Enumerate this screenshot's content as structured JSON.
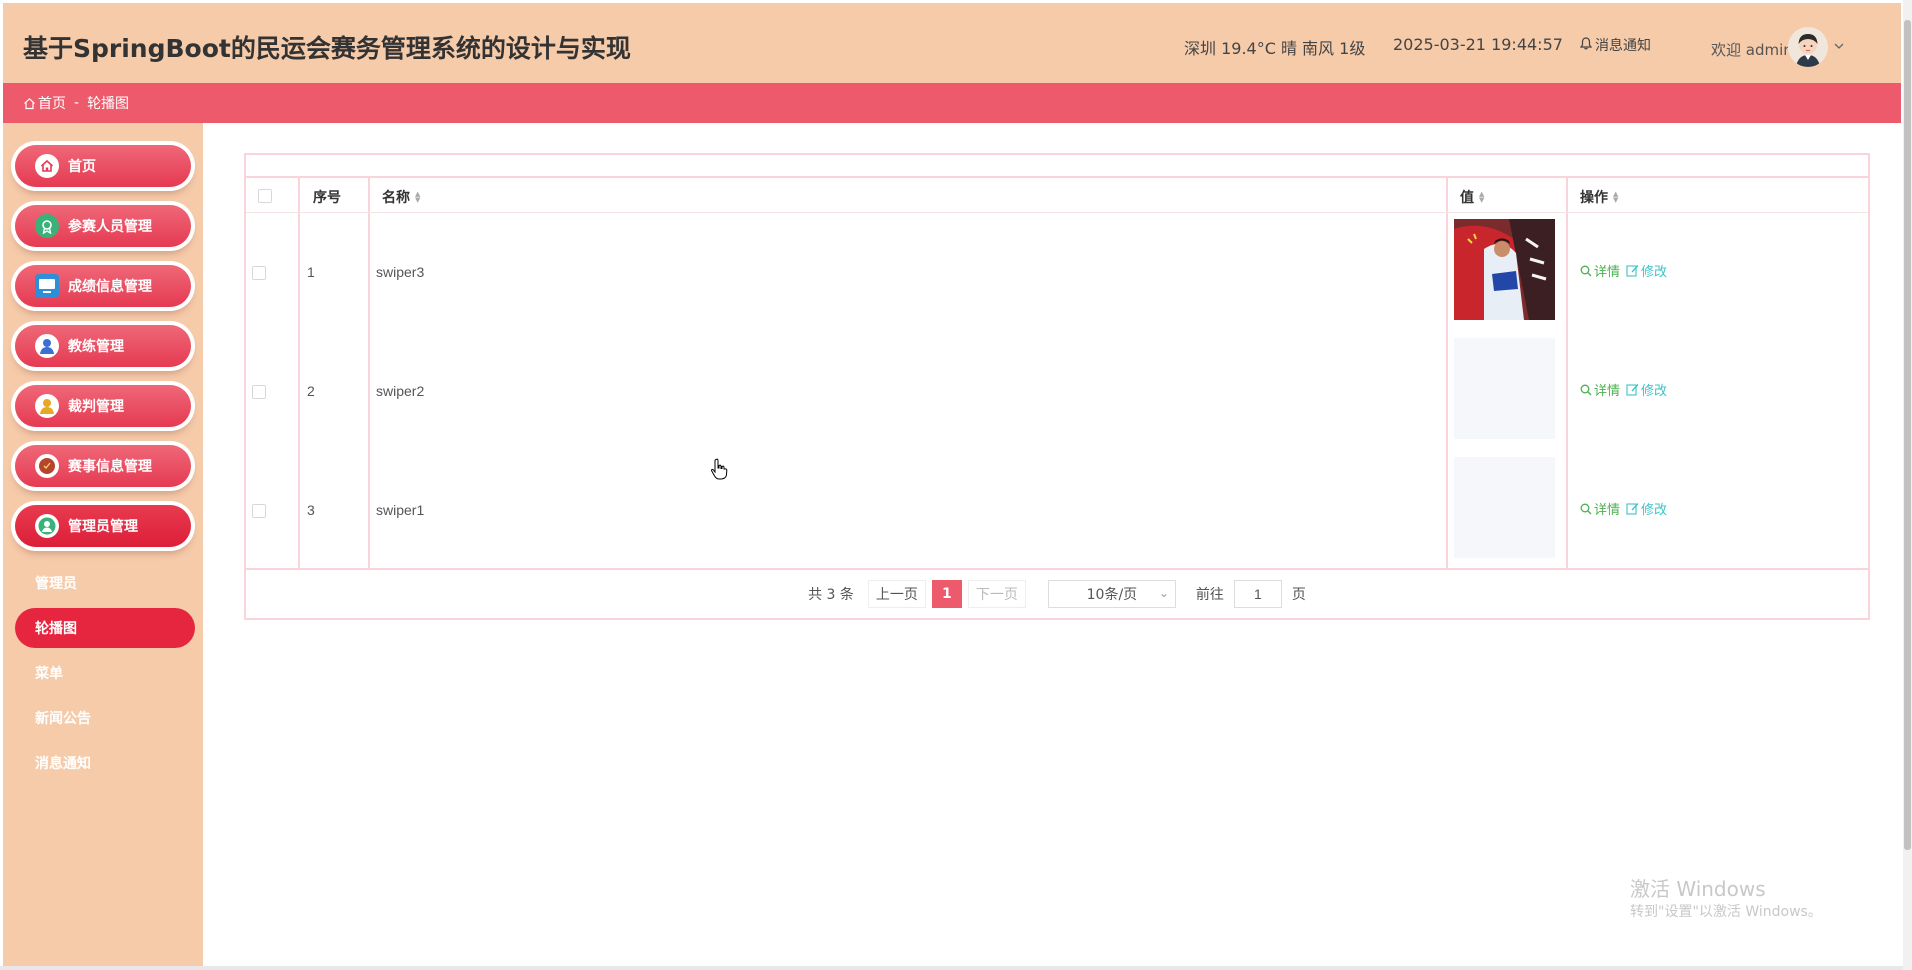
{
  "header": {
    "title": "基于SpringBoot的民运会赛务管理系统的设计与实现",
    "weather": "深圳 19.4°C 晴 南风 1级",
    "datetime": "2025-03-21 19:44:57",
    "notice_label": "消息通知",
    "welcome": "欢迎 admin"
  },
  "breadcrumb": {
    "home": "首页",
    "separator": "-",
    "current": "轮播图"
  },
  "sidebar": {
    "menu": [
      {
        "label": "首页",
        "icon": "home-icon"
      },
      {
        "label": "参赛人员管理",
        "icon": "badge-icon"
      },
      {
        "label": "成绩信息管理",
        "icon": "monitor-icon"
      },
      {
        "label": "教练管理",
        "icon": "user-icon"
      },
      {
        "label": "裁判管理",
        "icon": "user-icon"
      },
      {
        "label": "赛事信息管理",
        "icon": "ball-icon"
      },
      {
        "label": "管理员管理",
        "icon": "user-icon"
      }
    ],
    "submenu": [
      {
        "label": "管理员",
        "active": false
      },
      {
        "label": "轮播图",
        "active": true
      },
      {
        "label": "菜单",
        "active": false
      },
      {
        "label": "新闻公告",
        "active": false
      },
      {
        "label": "消息通知",
        "active": false
      }
    ]
  },
  "table": {
    "columns": {
      "index": "序号",
      "name": "名称",
      "value": "值",
      "actions": "操作"
    },
    "rows": [
      {
        "index": "1",
        "name": "swiper3",
        "has_image": true
      },
      {
        "index": "2",
        "name": "swiper2",
        "has_image": false
      },
      {
        "index": "3",
        "name": "swiper1",
        "has_image": false
      }
    ],
    "detail_label": "详情",
    "edit_label": "修改"
  },
  "pagination": {
    "total": "共 3 条",
    "prev": "上一页",
    "current_page": "1",
    "next": "下一页",
    "page_size": "10条/页",
    "goto_label": "前往",
    "goto_value": "1",
    "page_unit": "页"
  },
  "watermark": {
    "line1": "激活 Windows",
    "line2": "转到\"设置\"以激活 Windows。"
  },
  "colors": {
    "header_bg": "#f6cbaa",
    "accent": "#ec5a6c",
    "active_menu": "#e6263e"
  }
}
